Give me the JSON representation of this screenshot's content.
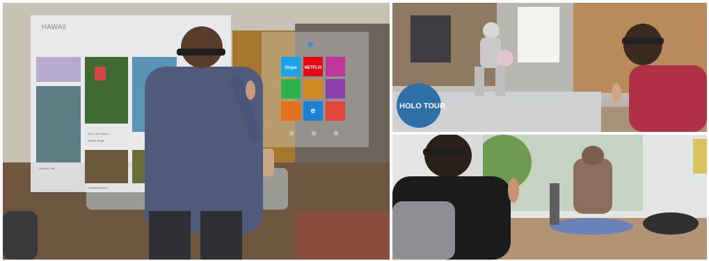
{
  "left_scene": {
    "window_title": "HAWAII",
    "tile_caption_1": "Life in the tropics",
    "tile_caption_2": "Sunset Ridge",
    "tile_caption_3": "Volcano Trail",
    "tile_caption_4": "Coastal Flowers",
    "app_tiles": [
      {
        "label": "Skype",
        "color": "#1aa3e8",
        "icon": "skype-icon"
      },
      {
        "label": "NETFLIX",
        "color": "#e50914",
        "icon": "netflix-icon"
      },
      {
        "label": "",
        "color": "#c0369a",
        "icon": "app-icon"
      },
      {
        "label": "",
        "color": "#2bb34a",
        "icon": "store-icon"
      },
      {
        "label": "",
        "color": "#d08a25",
        "icon": "app-icon"
      },
      {
        "label": "",
        "color": "#8b3fa8",
        "icon": "app-icon"
      },
      {
        "label": "",
        "color": "#e2731c",
        "icon": "app-icon"
      },
      {
        "label": "e",
        "color": "#1f7fd1",
        "icon": "edge-icon"
      },
      {
        "label": "",
        "color": "#e0473a",
        "icon": "music-icon"
      }
    ]
  },
  "top_right_scene": {
    "globe_text": "HOLO TOUR"
  }
}
